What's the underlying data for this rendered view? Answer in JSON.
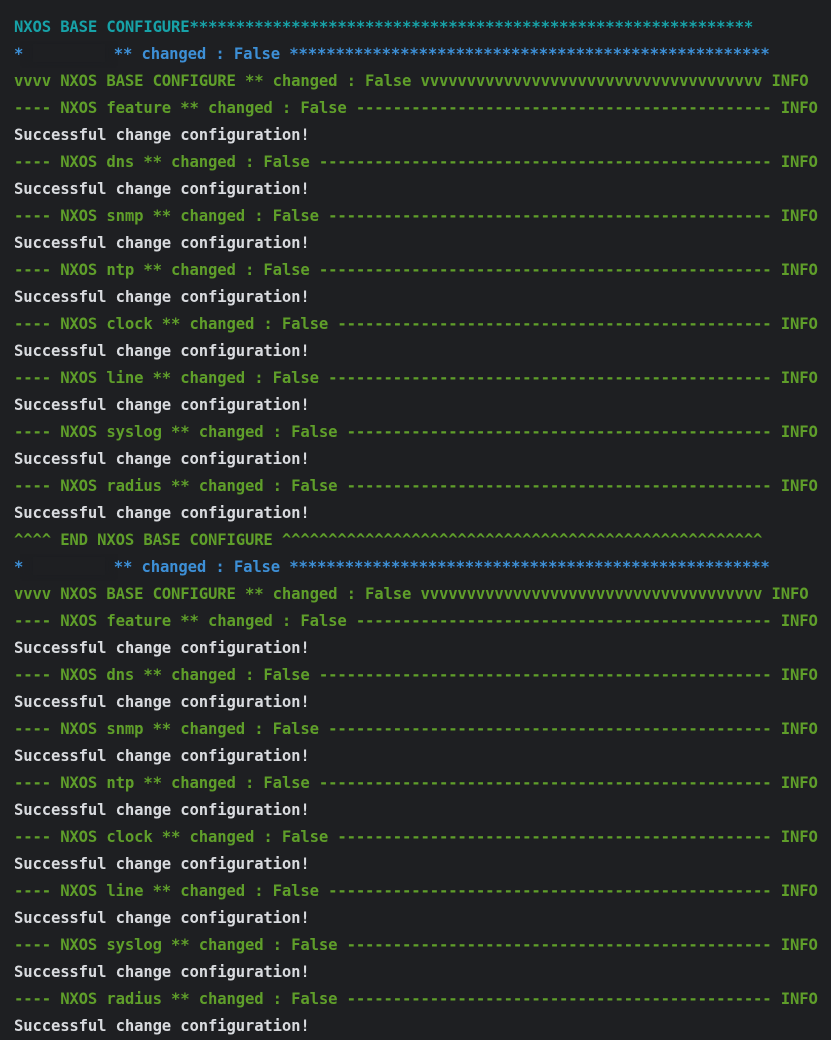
{
  "terminal": {
    "header": "NXOS BASE CONFIGURE*************************************************************",
    "hosts": [
      {
        "host_star": "*",
        "host_suffix": "** changed : False ****************************************************",
        "task_start": "vvvv NXOS BASE CONFIGURE ** changed : False vvvvvvvvvvvvvvvvvvvvvvvvvvvvvvvvvvvvv INFO",
        "subtasks": [
          {
            "header": "---- NXOS feature ** changed : False --------------------------------------------- INFO",
            "message": "Successful change configuration!"
          },
          {
            "header": "---- NXOS dns ** changed : False ------------------------------------------------- INFO",
            "message": "Successful change configuration!"
          },
          {
            "header": "---- NXOS snmp ** changed : False ------------------------------------------------ INFO",
            "message": "Successful change configuration!"
          },
          {
            "header": "---- NXOS ntp ** changed : False ------------------------------------------------- INFO",
            "message": "Successful change configuration!"
          },
          {
            "header": "---- NXOS clock ** changed : False ----------------------------------------------- INFO",
            "message": "Successful change configuration!"
          },
          {
            "header": "---- NXOS line ** changed : False ------------------------------------------------ INFO",
            "message": "Successful change configuration!"
          },
          {
            "header": "---- NXOS syslog ** changed : False ---------------------------------------------- INFO",
            "message": "Successful change configuration!"
          },
          {
            "header": "---- NXOS radius ** changed : False ---------------------------------------------- INFO",
            "message": "Successful change configuration!"
          }
        ],
        "task_end": "^^^^ END NXOS BASE CONFIGURE ^^^^^^^^^^^^^^^^^^^^^^^^^^^^^^^^^^^^^^^^^^^^^^^^^^^^"
      },
      {
        "host_star": "*",
        "host_suffix": "** changed : False ****************************************************",
        "task_start": "vvvv NXOS BASE CONFIGURE ** changed : False vvvvvvvvvvvvvvvvvvvvvvvvvvvvvvvvvvvvv INFO",
        "subtasks": [
          {
            "header": "---- NXOS feature ** changed : False --------------------------------------------- INFO",
            "message": "Successful change configuration!"
          },
          {
            "header": "---- NXOS dns ** changed : False ------------------------------------------------- INFO",
            "message": "Successful change configuration!"
          },
          {
            "header": "---- NXOS snmp ** changed : False ------------------------------------------------ INFO",
            "message": "Successful change configuration!"
          },
          {
            "header": "---- NXOS ntp ** changed : False ------------------------------------------------- INFO",
            "message": "Successful change configuration!"
          },
          {
            "header": "---- NXOS clock ** changed : False ----------------------------------------------- INFO",
            "message": "Successful change configuration!"
          },
          {
            "header": "---- NXOS line ** changed : False ------------------------------------------------ INFO",
            "message": "Successful change configuration!"
          },
          {
            "header": "---- NXOS syslog ** changed : False ---------------------------------------------- INFO",
            "message": "Successful change configuration!"
          },
          {
            "header": "---- NXOS radius ** changed : False ---------------------------------------------- INFO",
            "message": "Successful change configuration!"
          }
        ],
        "task_end": ""
      }
    ]
  },
  "colors": {
    "background": "#1e1f22",
    "header": "#17a2a8",
    "host": "#3d8fd6",
    "task": "#5f9e2a",
    "message": "#d9dbdf"
  }
}
